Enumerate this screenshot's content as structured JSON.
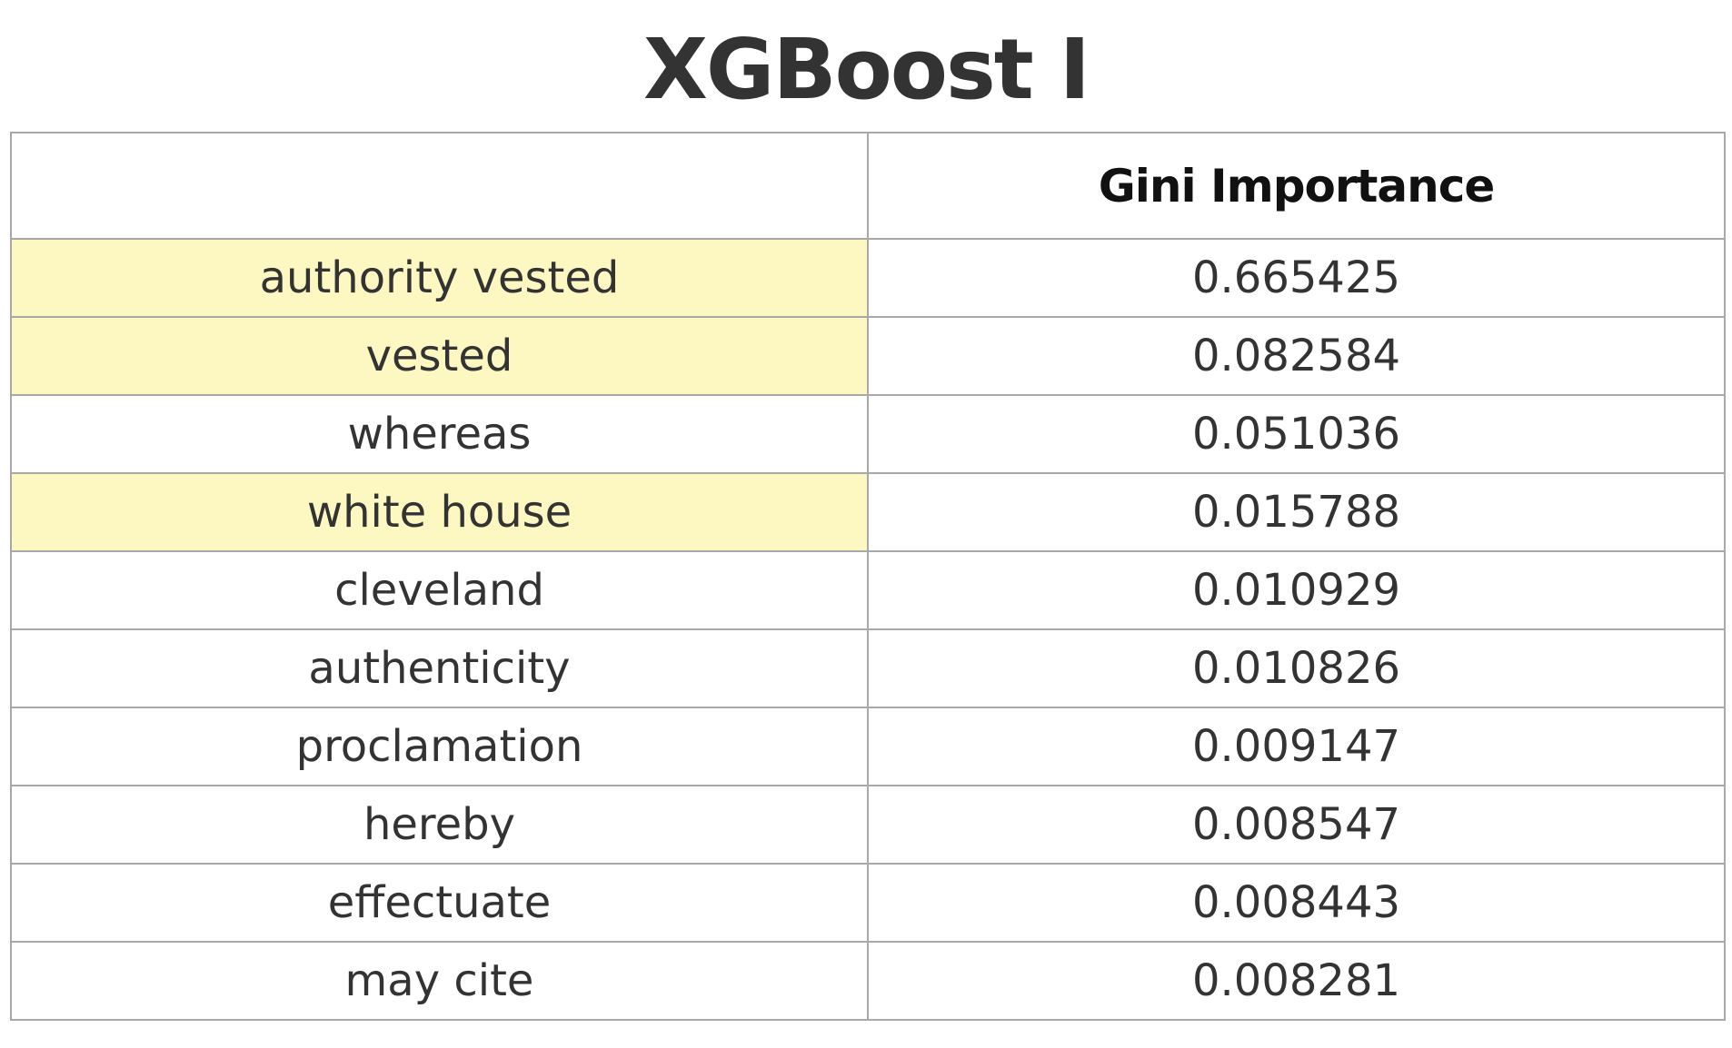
{
  "title": "XGBoost I",
  "chart_data": {
    "type": "table",
    "title": "XGBoost I",
    "columns": [
      "",
      "Gini Importance"
    ],
    "highlight_color": "#fdf8c2",
    "rows": [
      {
        "feature": "authority vested",
        "value": "0.665425",
        "highlighted": true
      },
      {
        "feature": "vested",
        "value": "0.082584",
        "highlighted": true
      },
      {
        "feature": "whereas",
        "value": "0.051036",
        "highlighted": false
      },
      {
        "feature": "white house",
        "value": "0.015788",
        "highlighted": true
      },
      {
        "feature": "cleveland",
        "value": "0.010929",
        "highlighted": false
      },
      {
        "feature": "authenticity",
        "value": "0.010826",
        "highlighted": false
      },
      {
        "feature": "proclamation",
        "value": "0.009147",
        "highlighted": false
      },
      {
        "feature": "hereby",
        "value": "0.008547",
        "highlighted": false
      },
      {
        "feature": "effectuate",
        "value": "0.008443",
        "highlighted": false
      },
      {
        "feature": "may cite",
        "value": "0.008281",
        "highlighted": false
      }
    ]
  }
}
